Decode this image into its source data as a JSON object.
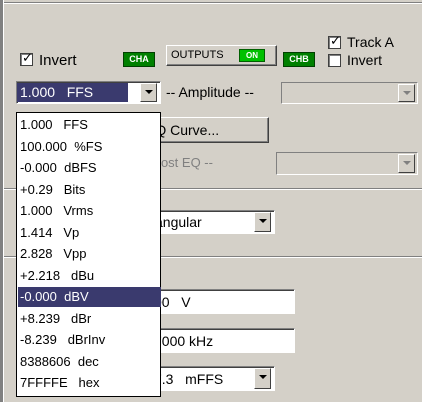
{
  "channel_a": {
    "invert_label": "Invert",
    "invert_checked": true,
    "badge": "CHA"
  },
  "outputs": {
    "label": "OUTPUTS",
    "status": "ON"
  },
  "channel_b": {
    "badge": "CHB",
    "track_a_label": "Track A",
    "track_a_checked": true,
    "invert_label": "Invert",
    "invert_checked": false
  },
  "amplitude": {
    "unit_value": "1.000   FFS",
    "label": "-- Amplitude --"
  },
  "eq": {
    "curve_button": "EQ Curve...",
    "post_eq_label": "-- Post EQ --"
  },
  "waveform": {
    "value": "angular"
  },
  "fields": {
    "frequency": "00   V",
    "frequency2": "7000 kHz",
    "offset": "7.3   mFFS"
  },
  "unit_list": {
    "items": [
      "1.000   FFS",
      "100.000  %FS",
      "-0.000  dBFS",
      "+0.29   Bits",
      "1.000   Vrms",
      "1.414   Vp",
      "2.828   Vpp",
      "+2.218   dBu",
      "-0.000  dBV",
      "+8.239   dBr",
      "-8.239   dBrInv",
      "8388606  dec",
      "7FFFFE   hex"
    ],
    "selected_index": 8
  },
  "check_mark": "✓"
}
